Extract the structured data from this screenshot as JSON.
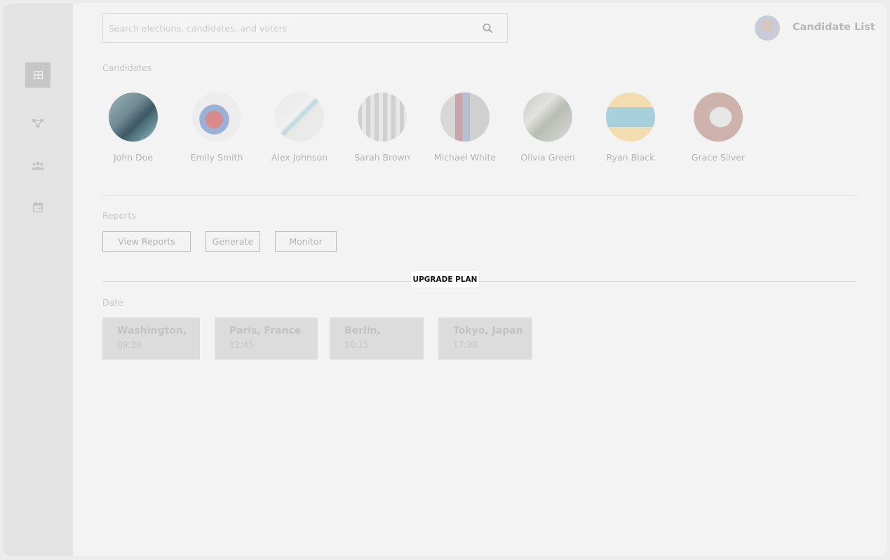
{
  "search": {
    "placeholder": "Search elections, candidates, and voters"
  },
  "header": {
    "title": "Candidate List"
  },
  "sidebar": {
    "items": [
      {
        "icon": "grid-icon",
        "active": true
      },
      {
        "icon": "network-icon",
        "active": false
      },
      {
        "icon": "users-icon",
        "active": false
      },
      {
        "icon": "calendar-icon",
        "active": false
      }
    ]
  },
  "candidates": {
    "label": "Candidates",
    "items": [
      {
        "name": "John Doe"
      },
      {
        "name": "Emily Smith"
      },
      {
        "name": "Alex Johnson"
      },
      {
        "name": "Sarah Brown"
      },
      {
        "name": "Michael White"
      },
      {
        "name": "Olivia Green"
      },
      {
        "name": "Ryan Black"
      },
      {
        "name": "Grace Silver"
      }
    ]
  },
  "reports": {
    "label": "Reports",
    "buttons": [
      "View Reports",
      "Generate",
      "Monitor"
    ]
  },
  "upgrade": {
    "label": "UPGRADE PLAN"
  },
  "dates": {
    "label": "Date",
    "items": [
      {
        "city": "Washington,",
        "time": "09:30"
      },
      {
        "city": "Paris, France",
        "time": "12:45"
      },
      {
        "city": "Berlin,",
        "time": "10:15"
      },
      {
        "city": "Tokyo, Japan",
        "time": "17:30"
      }
    ]
  },
  "colors": {
    "sidebar_bg": "#e3e3e3",
    "content_bg": "#f3f3f3",
    "active_item": "#c6c6c6",
    "card_bg": "#dcdcdc"
  }
}
